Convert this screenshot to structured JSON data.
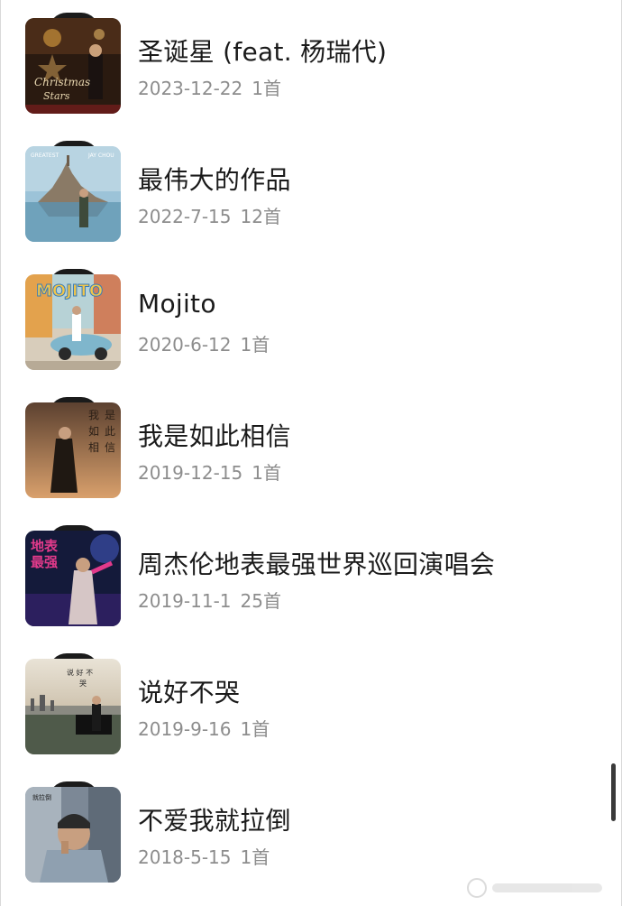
{
  "albums": [
    {
      "title": "圣诞星 (feat. 杨瑞代)",
      "date": "2023-12-22",
      "count": "1首",
      "cover_icon": "christmas-star-cover"
    },
    {
      "title": "最伟大的作品",
      "date": "2022-7-15",
      "count": "12首",
      "cover_icon": "greatest-works-cover"
    },
    {
      "title": "Mojito",
      "date": "2020-6-12",
      "count": "1首",
      "cover_icon": "mojito-cover"
    },
    {
      "title": "我是如此相信",
      "date": "2019-12-15",
      "count": "1首",
      "cover_icon": "i-believe-cover"
    },
    {
      "title": "周杰伦地表最强世界巡回演唱会",
      "date": "2019-11-1",
      "count": "25首",
      "cover_icon": "world-tour-cover"
    },
    {
      "title": "说好不哭",
      "date": "2019-9-16",
      "count": "1首",
      "cover_icon": "wont-cry-cover"
    },
    {
      "title": "不爱我就拉倒",
      "date": "2018-5-15",
      "count": "1首",
      "cover_icon": "if-you-dont-love-me-cover"
    }
  ],
  "colors": {
    "title": "#1a1a1a",
    "meta": "#8d8d8d",
    "background": "#ffffff"
  }
}
